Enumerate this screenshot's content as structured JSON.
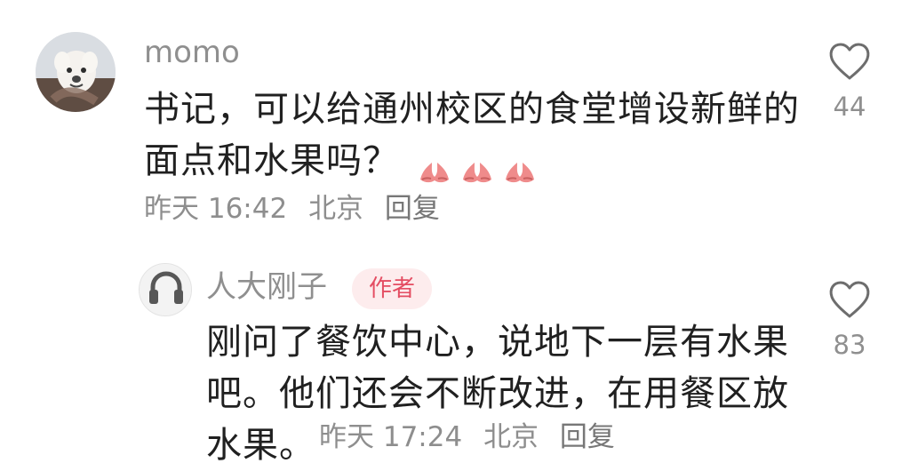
{
  "comment": {
    "username": "momo",
    "text_line_1": "书记，可以给通州校区的食堂增设新鲜的",
    "text_line_2": "面点和水果吗？",
    "emoji": "praying-hands",
    "time": "昨天 16:42",
    "location": "北京",
    "reply_label": "回复",
    "likes": "44",
    "avatar_icon": "dog-avatar-icon"
  },
  "reply": {
    "username": "人大刚子",
    "author_badge": "作者",
    "text_line_1": "刚问了餐饮中心，说地下一层有水果",
    "text_line_2": "吧。他们还会不断改进，在用餐区放",
    "text_line_3": "水果。",
    "time": "昨天 17:24",
    "location": "北京",
    "reply_label": "回复",
    "likes": "83",
    "avatar_icon": "headphones-avatar-icon"
  },
  "colors": {
    "badge_bg": "#fdeced",
    "badge_text": "#e44d62",
    "meta_text": "#8e8e8e",
    "username_text": "#8f8f8f",
    "comment_text": "#202020"
  }
}
